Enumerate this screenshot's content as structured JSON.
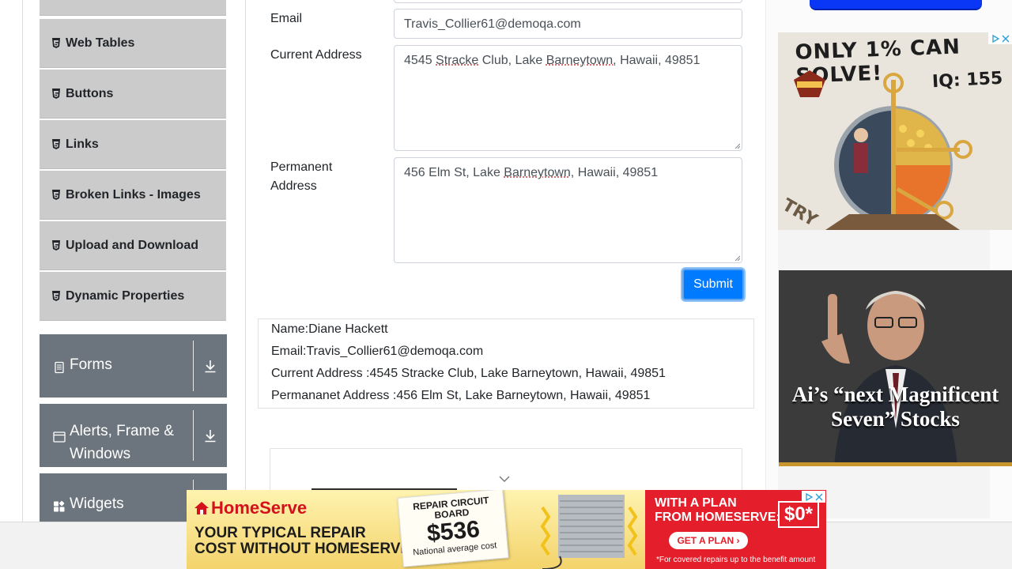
{
  "sidebar": {
    "items": [
      {
        "label": "Web Tables"
      },
      {
        "label": "Buttons"
      },
      {
        "label": "Links"
      },
      {
        "label": "Broken Links - Images"
      },
      {
        "label": "Upload and Download"
      },
      {
        "label": "Dynamic Properties"
      }
    ],
    "groups": [
      {
        "label": "Forms",
        "icon": "form-icon"
      },
      {
        "label": "Alerts, Frame & Windows",
        "icon": "window-icon"
      },
      {
        "label": "Widgets",
        "icon": "widgets-icon"
      }
    ]
  },
  "form": {
    "email_label": "Email",
    "email_value": "Travis_Collier61@demoqa.com",
    "current_address_label": "Current Address",
    "current_address_parts": [
      "4545 ",
      "Stracke",
      " Club, Lake ",
      "Barneytown,",
      " Hawaii, 49851"
    ],
    "permanent_address_label": "Permanent Address",
    "permanent_address_parts": [
      "456 Elm St, Lake ",
      "Barneytown",
      ", Hawaii, 49851"
    ],
    "submit_label": "Submit"
  },
  "output": {
    "name": "Name:Diane Hackett",
    "email": "Email:Travis_Collier61@demoqa.com",
    "current_address": "Current Address :4545 Stracke Club, Lake Barneytown, Hawaii, 49851",
    "permanent_address": "Permananet Address :456 Elm St, Lake Barneytown, Hawaii, 49851"
  },
  "ads": {
    "ad1_line1": "ONLY 1% CAN SOLVE!",
    "ad1_line2": "IQ: 155",
    "ad1_try": "TRY",
    "ad2_text": "Ai’s “next Magnificent Seven” Stocks",
    "bottom_brand": "HomeServe",
    "bottom_line1": "YOUR TYPICAL REPAIR",
    "bottom_line2": "COST WITHOUT HOMESERVE:",
    "card_title": "REPAIR CIRCUIT BOARD",
    "card_price": "$536",
    "card_note": "National average cost",
    "right_line1": "WITH A PLAN",
    "right_line2": "FROM HOMESERVE:",
    "right_price": "$0*",
    "right_cta": "GET A PLAN ›",
    "right_fine": "*For covered repairs up to the benefit amount"
  },
  "colors": {
    "primary": "#007bff",
    "sidebar_item_bg": "#cbcbcb",
    "group_bg": "#6c757d"
  }
}
